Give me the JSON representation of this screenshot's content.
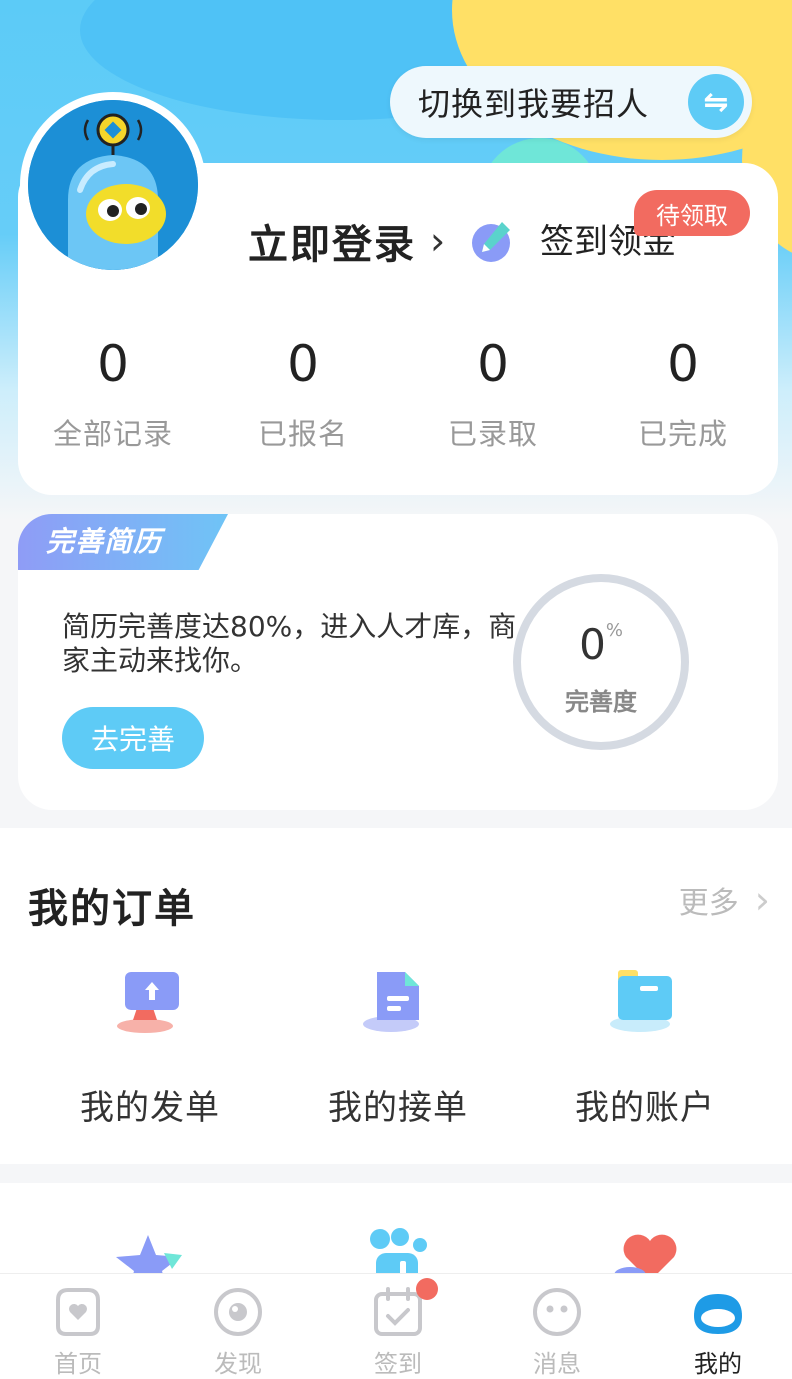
{
  "header": {
    "switch_label": "切换到我要招人",
    "switch_icon": "swap-icon"
  },
  "profile": {
    "login_label": "立即登录",
    "sign_label": "签到领金币",
    "badge_label": "待领取",
    "stats": [
      {
        "value": "0",
        "label": "全部记录"
      },
      {
        "value": "0",
        "label": "已报名"
      },
      {
        "value": "0",
        "label": "已录取"
      },
      {
        "value": "0",
        "label": "已完成"
      }
    ]
  },
  "resume": {
    "tag": "完善简历",
    "description": "简历完善度达80%，进入人才库，商家主动来找你。",
    "button": "去完善",
    "progress_value": "0",
    "progress_unit": "%",
    "progress_label": "完善度",
    "progress_fraction": 0
  },
  "orders": {
    "title": "我的订单",
    "more": "更多",
    "items": [
      {
        "label": "我的发单",
        "icon": "publish-order-icon"
      },
      {
        "label": "我的接单",
        "icon": "receive-order-icon"
      },
      {
        "label": "我的账户",
        "icon": "account-wallet-icon"
      }
    ]
  },
  "extra_icons": [
    "star-icon",
    "team-icon",
    "heart-icon"
  ],
  "nav": {
    "items": [
      {
        "label": "首页",
        "icon": "home-icon"
      },
      {
        "label": "发现",
        "icon": "discover-icon"
      },
      {
        "label": "签到",
        "icon": "calendar-check-icon"
      },
      {
        "label": "消息",
        "icon": "message-icon"
      },
      {
        "label": "我的",
        "icon": "profile-icon"
      }
    ],
    "active_index": 4
  },
  "colors": {
    "accent": "#5ecbf6",
    "badge": "#f26b60",
    "yellow": "#ffe066"
  }
}
